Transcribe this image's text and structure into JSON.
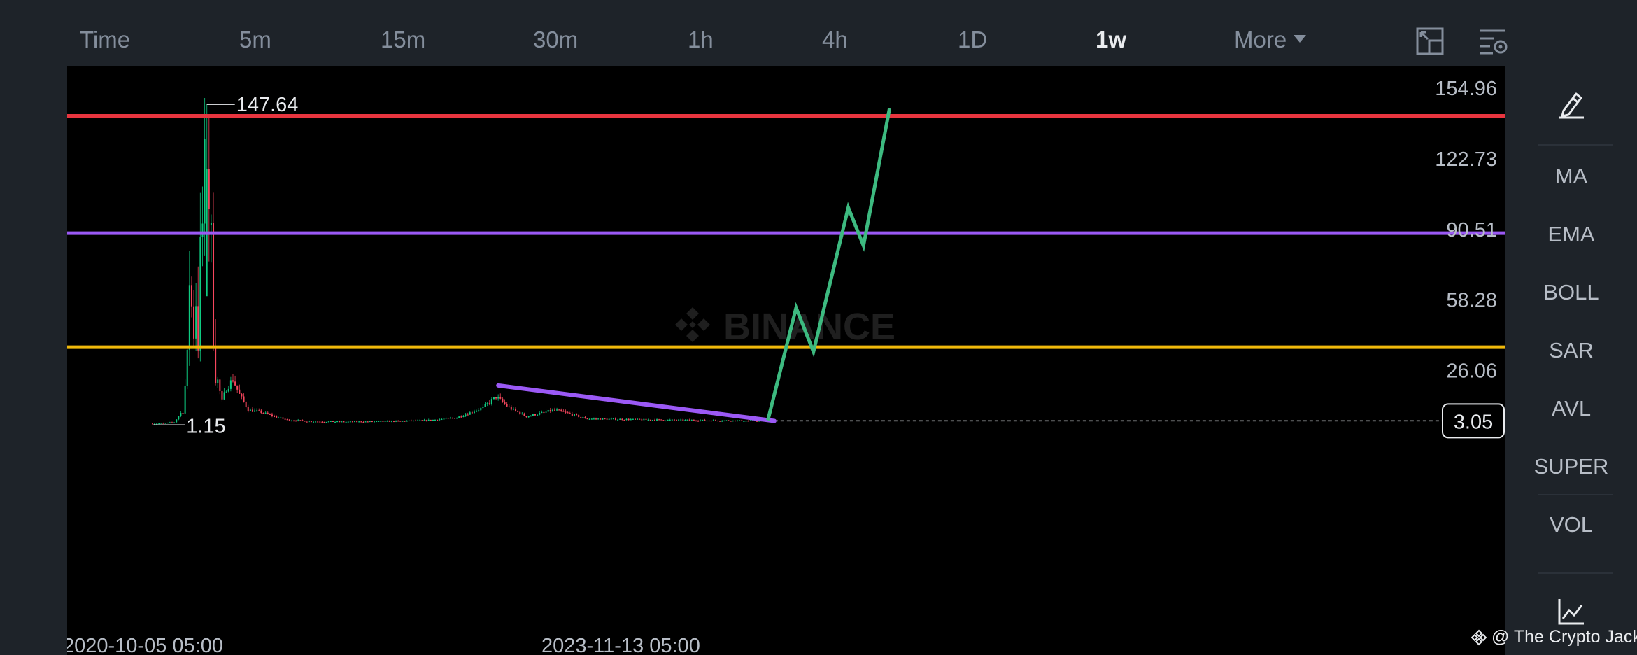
{
  "toolbar": {
    "timeframes": [
      {
        "label": "Time",
        "active": false
      },
      {
        "label": "5m",
        "active": false
      },
      {
        "label": "15m",
        "active": false
      },
      {
        "label": "30m",
        "active": false
      },
      {
        "label": "1h",
        "active": false
      },
      {
        "label": "4h",
        "active": false
      },
      {
        "label": "1D",
        "active": false
      },
      {
        "label": "1w",
        "active": true
      }
    ],
    "more_label": "More",
    "icons": [
      "fullscreen-icon",
      "chart-settings-icon"
    ]
  },
  "sidebar": {
    "draw_icon": "pencil-icon",
    "indicators": [
      "MA",
      "EMA",
      "BOLL",
      "SAR",
      "AVL",
      "SUPER",
      "VOL"
    ],
    "bottom_icon": "line-chart-icon"
  },
  "watermark": "BINANCE",
  "credit": "@ The Crypto Jack",
  "colors": {
    "background": "#000000",
    "panel": "#1e2329",
    "up": "#0ecb81",
    "down": "#f6465d",
    "resistance": "#e8353f",
    "mid": "#9b59f5",
    "support": "#f0b90b",
    "projection": "#3dba80",
    "trendline": "#9b59f5"
  },
  "chart_data": {
    "type": "candlestick",
    "interval": "1w",
    "price_axis": {
      "ticks": [
        154.96,
        122.73,
        90.51,
        58.28,
        26.06
      ],
      "range": [
        -5,
        165
      ]
    },
    "x_labels": [
      "2020-10-05 05:00",
      "2023-11-13 05:00"
    ],
    "current_price": "3.05",
    "annotations": {
      "high": {
        "label": "147.64",
        "value": 147.64
      },
      "low": {
        "label": "1.15",
        "value": 1.15
      }
    },
    "horizontal_levels": [
      {
        "value": 142.4,
        "color": "#e8353f"
      },
      {
        "value": 88.8,
        "color": "#9b59f5"
      },
      {
        "value": 36.7,
        "color": "#f0b90b"
      }
    ],
    "trendline": {
      "from": {
        "week": 159,
        "price": 19.2
      },
      "to": {
        "week": 286,
        "price": 3.0
      }
    },
    "projection_path": [
      {
        "week": 283,
        "price": 3.3
      },
      {
        "week": 296,
        "price": 54.7
      },
      {
        "week": 304,
        "price": 34.6
      },
      {
        "week": 320,
        "price": 100.5
      },
      {
        "week": 327,
        "price": 83.1
      },
      {
        "week": 339,
        "price": 145.8
      }
    ]
  }
}
